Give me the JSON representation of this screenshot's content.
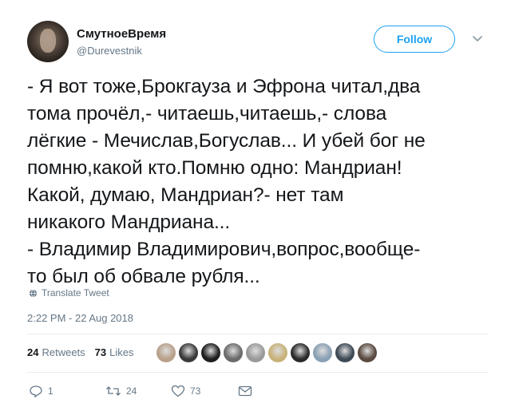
{
  "user": {
    "name": "СмутноеВремя",
    "handle": "@Durevestnik"
  },
  "follow_label": "Follow",
  "tweet_text": "- Я вот тоже,Брокгауза и Эфрона читал,два\nтома прочёл,- читаешь,читаешь,- слова\nлёгкие - Мечислав,Богуслав... И убей бог не\nпомню,какой кто.Помню одно: Мандриан!\nКакой, думаю, Мандриан?- нет там\nникакого Мандриана...\n- Владимир Владимирович,вопрос,вообще-\nто был об обвале рубля...",
  "translate_label": "Translate Tweet",
  "timestamp": "2:22 PM - 22 Aug 2018",
  "stats": {
    "retweets_count": "24",
    "retweets_label": "Retweets",
    "likes_count": "73",
    "likes_label": "Likes"
  },
  "liker_avatars": [
    "#b9a08a",
    "#3a3a3a",
    "#1e1e1e",
    "#6b6b6b",
    "#9a9a9a",
    "#c9b27a",
    "#2a2a2a",
    "#8aa0b4",
    "#3e4a56",
    "#5a4a40"
  ],
  "actions": {
    "replies": "1",
    "retweets": "24",
    "likes": "73"
  },
  "colors": {
    "accent": "#1da1f2",
    "muted": "#657786",
    "text": "#14171a"
  }
}
